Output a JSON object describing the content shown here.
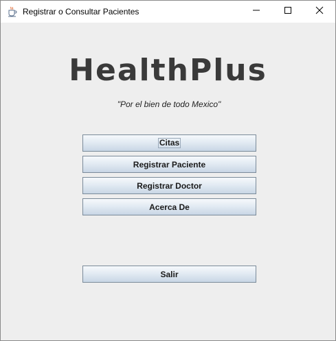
{
  "window": {
    "title": "Registrar o Consultar Pacientes",
    "icon": "java-cup-icon",
    "controls": [
      "minimize-icon",
      "maximize-icon",
      "close-icon"
    ]
  },
  "main": {
    "logo": "HealthPlus",
    "slogan": "\"Por el bien de todo Mexico\"",
    "buttons": {
      "citas": "Citas",
      "registrar_paciente": "Registrar Paciente",
      "registrar_doctor": "Registrar Doctor",
      "acerca_de": "Acerca De",
      "salir": "Salir"
    },
    "focused_button": "Citas"
  },
  "colors": {
    "window_bg": "#eeeeee",
    "titlebar_bg": "#ffffff",
    "logo_text": "#3a3a3a",
    "button_border": "#7a8a99"
  }
}
